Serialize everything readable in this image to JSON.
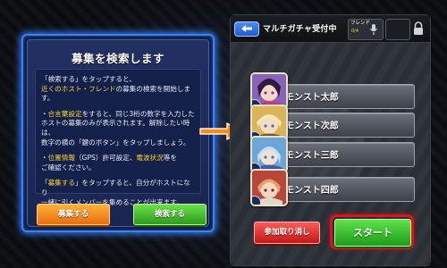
{
  "search_panel": {
    "title": "募集を検索します",
    "lines": [
      {
        "pre": "「検索する」をタップすると、",
        "hl": "",
        "post": ""
      },
      {
        "pre": "",
        "hl": "近くのホスト・フレンド",
        "post": "の募集の検索を開始します。"
      },
      {
        "pre": "・",
        "hl": "合言葉設定",
        "post": "をすると、同じ3桁の数字を入力した"
      },
      {
        "pre": "ホストの募集のみが表示されます。解除したい時は、",
        "hl": "",
        "post": ""
      },
      {
        "pre": "数字の横の「鍵のボタン」をタップしましょう。",
        "hl": "",
        "post": ""
      },
      {
        "pre": "・",
        "hl": "位置情報",
        "post": "（GPS）許可設定、"
      },
      {
        "pre": "",
        "hl": "電波状況",
        "post": "等を"
      },
      {
        "pre": "ご確認ください。",
        "hl": "",
        "post": ""
      },
      {
        "pre": "「",
        "hl": "募集する",
        "post": "」をタップすると、自分がホストになり"
      },
      {
        "pre": "一緒に引くメンバーを集めることが出来ます。",
        "hl": "",
        "post": ""
      }
    ],
    "recruit_button": "募集する",
    "search_button": "検索する"
  },
  "multi_screen": {
    "title": "マルチガチャ受付中",
    "friend_label": "フレンド",
    "friend_sub": "0/4",
    "players": [
      {
        "name": "モンスト太郎"
      },
      {
        "name": "モンスト次郎"
      },
      {
        "name": "モンスト三郎"
      },
      {
        "name": "モンスト四郎"
      }
    ],
    "cancel_button": "参加取り消し",
    "start_button": "スタート"
  },
  "colors": {
    "highlight": "#ffd53a",
    "panel_glow": "#3e7fff",
    "arrow": "#ff8a1a",
    "start_ring": "#e0121a"
  },
  "icons": [
    "back-arrow-icon",
    "mic-icon",
    "lock-icon",
    "pointer-arrow-icon"
  ]
}
